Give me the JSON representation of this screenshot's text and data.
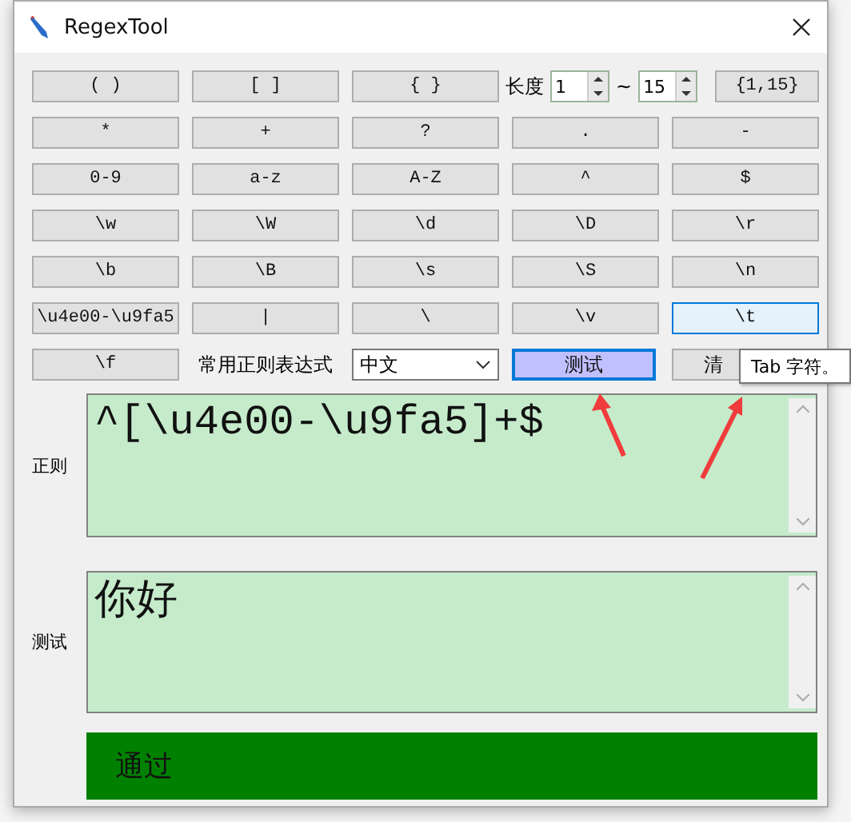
{
  "window": {
    "title": "RegexTool"
  },
  "palette": {
    "rows": [
      [
        {
          "kind": "button",
          "label": "( )",
          "hovered": false
        },
        {
          "kind": "button",
          "label": "[ ]",
          "hovered": false
        },
        {
          "kind": "button",
          "label": "{ }",
          "hovered": false
        },
        {
          "kind": "length",
          "label": "长度",
          "min": "1",
          "separator": "~",
          "max": "15"
        },
        {
          "kind": "button",
          "label": "{1,15}",
          "hovered": false
        }
      ],
      [
        {
          "kind": "button",
          "label": "*",
          "hovered": false
        },
        {
          "kind": "button",
          "label": "+",
          "hovered": false
        },
        {
          "kind": "button",
          "label": "?",
          "hovered": false
        },
        {
          "kind": "button",
          "label": ".",
          "hovered": false
        },
        {
          "kind": "button",
          "label": "-",
          "hovered": false
        }
      ],
      [
        {
          "kind": "button",
          "label": "0-9",
          "hovered": false
        },
        {
          "kind": "button",
          "label": "a-z",
          "hovered": false
        },
        {
          "kind": "button",
          "label": "A-Z",
          "hovered": false
        },
        {
          "kind": "button",
          "label": "^",
          "hovered": false
        },
        {
          "kind": "button",
          "label": "$",
          "hovered": false
        }
      ],
      [
        {
          "kind": "button",
          "label": "\\w",
          "hovered": false
        },
        {
          "kind": "button",
          "label": "\\W",
          "hovered": false
        },
        {
          "kind": "button",
          "label": "\\d",
          "hovered": false
        },
        {
          "kind": "button",
          "label": "\\D",
          "hovered": false
        },
        {
          "kind": "button",
          "label": "\\r",
          "hovered": false
        }
      ],
      [
        {
          "kind": "button",
          "label": "\\b",
          "hovered": false
        },
        {
          "kind": "button",
          "label": "\\B",
          "hovered": false
        },
        {
          "kind": "button",
          "label": "\\s",
          "hovered": false
        },
        {
          "kind": "button",
          "label": "\\S",
          "hovered": false
        },
        {
          "kind": "button",
          "label": "\\n",
          "hovered": false
        }
      ],
      [
        {
          "kind": "button",
          "label": "\\u4e00-\\u9fa5",
          "hovered": false
        },
        {
          "kind": "button",
          "label": "|",
          "hovered": false
        },
        {
          "kind": "button",
          "label": "\\",
          "hovered": false
        },
        {
          "kind": "button",
          "label": "\\v",
          "hovered": false
        },
        {
          "kind": "button",
          "label": "\\t",
          "hovered": true
        }
      ],
      [
        {
          "kind": "button",
          "label": "\\f",
          "hovered": false
        },
        {
          "kind": "label",
          "label": "常用正则表达式"
        },
        {
          "kind": "select",
          "value": "中文"
        },
        {
          "kind": "action",
          "label": "测试",
          "focused": true
        },
        {
          "kind": "action",
          "label": "清",
          "focused": false
        }
      ]
    ]
  },
  "tooltip": {
    "text": "Tab 字符。"
  },
  "regex": {
    "label": "正则",
    "value": "^[\\u4e00-\\u9fa5]+$"
  },
  "test": {
    "label": "测试",
    "value": "你好"
  },
  "result": {
    "text": "通过",
    "passed": true
  },
  "annotations": [
    {
      "kind": "arrow"
    },
    {
      "kind": "arrow"
    }
  ]
}
